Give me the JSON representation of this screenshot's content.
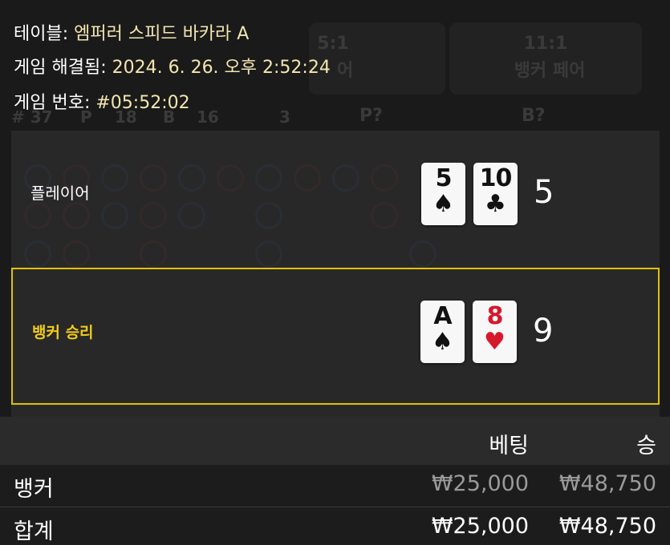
{
  "info": {
    "table_label": "테이블:",
    "table_value": "엠퍼러 스피드 바카라 A",
    "resolved_label": "게임 해결됨:",
    "resolved_value": "2024. 6. 26. 오후 2:52:24",
    "number_label": "게임 번호:",
    "number_value": "#05:52:02"
  },
  "background": {
    "texts": [
      "5:1",
      "11:1",
      "뱅커 페어",
      "# 37",
      "P",
      "18",
      "B",
      "16",
      "3",
      "P?",
      "B?",
      "어"
    ]
  },
  "result": {
    "player": {
      "label": "플레이어",
      "score": "5",
      "cards": [
        {
          "rank": "5",
          "suit": "♠",
          "color": "black"
        },
        {
          "rank": "10",
          "suit": "♣",
          "color": "black"
        }
      ]
    },
    "banker": {
      "label": "뱅커 승리",
      "score": "9",
      "cards": [
        {
          "rank": "A",
          "suit": "♠",
          "color": "black"
        },
        {
          "rank": "8",
          "suit": "♥",
          "color": "red"
        }
      ]
    }
  },
  "bets": {
    "headers": {
      "bet": "베팅",
      "win": "승"
    },
    "rows": [
      {
        "name": "뱅커",
        "bet": "₩25,000",
        "win": "₩48,750"
      }
    ],
    "total": {
      "name": "합계",
      "bet": "₩25,000",
      "win": "₩48,750"
    }
  },
  "colors": {
    "highlight": "#e2c200",
    "banker_label": "#f1cc1a",
    "red_suit": "#d7182a"
  }
}
